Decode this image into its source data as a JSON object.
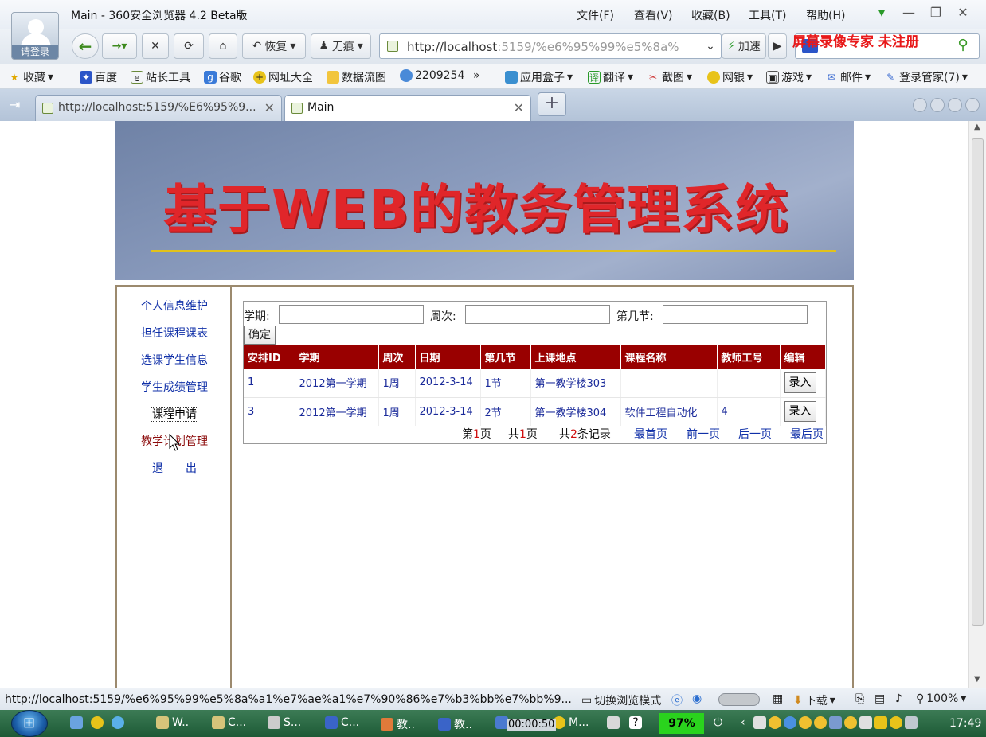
{
  "browser": {
    "window_title": "Main - 360安全浏览器 4.2 Beta版",
    "avatar_label": "请登录",
    "menus": [
      "文件(F)",
      "查看(V)",
      "收藏(B)",
      "工具(T)",
      "帮助(H)"
    ],
    "restore_label": "恢复",
    "private_label": "无痕",
    "address_url_host": "http://localhost",
    "address_url_rest": ":5159/%e6%95%99%e5%8a%",
    "accelerate_label": "加速",
    "watermark": "屏幕录像专家  未注册",
    "bookmarks": [
      "收藏",
      "百度",
      "站长工具",
      "谷歌",
      "网址大全",
      "数据流图",
      "2209254",
      "»",
      "应用盒子",
      "翻译",
      "截图",
      "网银",
      "游戏",
      "邮件",
      "登录管家(7)"
    ],
    "tabs": [
      {
        "label": "http://localhost:5159/%E6%95%9..."
      },
      {
        "label": "Main"
      }
    ]
  },
  "page": {
    "banner_title": "基于WEB的教务管理系统",
    "nav": [
      "个人信息维护",
      "担任课程课表",
      "选课学生信息",
      "学生成绩管理",
      "课程申请",
      "教学计划管理",
      "退　　出"
    ],
    "filter": {
      "term_label": "学期:",
      "week_label": "周次:",
      "period_label": "第几节:",
      "term_value": "",
      "week_value": "",
      "period_value": "",
      "submit_label": "确定"
    },
    "table": {
      "headers": [
        "安排ID",
        "学期",
        "周次",
        "日期",
        "第几节",
        "上课地点",
        "课程名称",
        "教师工号",
        "编辑"
      ],
      "rows": [
        [
          "1",
          "2012第一学期",
          "1周",
          "2012-3-14",
          "1节",
          "第一教学楼303",
          "",
          "",
          "录入"
        ],
        [
          "3",
          "2012第一学期",
          "1周",
          "2012-3-14",
          "2节",
          "第一教学楼304",
          "软件工程自动化",
          "4",
          "录入"
        ]
      ]
    },
    "pager": {
      "page_prefix": "第",
      "page_num": "1",
      "page_suffix": "页",
      "total_prefix": "共",
      "total_pages": "1",
      "total_suffix": "页",
      "records_prefix": "共",
      "records_count": "2",
      "records_suffix": "条记录",
      "first": "最首页",
      "prev": "前一页",
      "next": "后一页",
      "last": "最后页"
    }
  },
  "status": {
    "url": "http://localhost:5159/%e6%95%99%e5%8a%a1%e7%ae%a1%e7%90%86%e7%b3%bb%e7%bb%9...",
    "switch_mode": "切换浏览模式",
    "download": "下载",
    "zoom": "100%"
  },
  "taskbar": {
    "items": [
      "W..",
      "C...",
      "S...",
      "C...",
      "教..",
      "教..",
      "M..."
    ],
    "timer": "00:00:50",
    "battery": "97%",
    "clock": "17:49"
  },
  "colors": {
    "table_header": "#990000",
    "link": "#1030a8",
    "banner_text": "#e0262a"
  }
}
